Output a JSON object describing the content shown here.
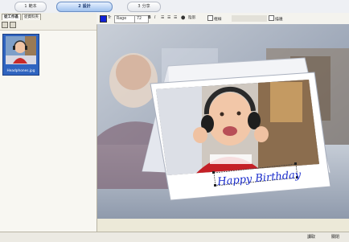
{
  "steps": [
    {
      "num": "1",
      "label": "範本"
    },
    {
      "num": "2",
      "label": "設計"
    },
    {
      "num": "3",
      "label": "分享"
    }
  ],
  "tabs": {
    "active": "從工作區",
    "other": "從資料夾"
  },
  "thumb": {
    "filename": "Headphones.jpg"
  },
  "toolbar": {
    "font_prefix": "Tr",
    "font_name": "Rage",
    "font_size": "72",
    "bold": "B",
    "italic": "I",
    "shadow_label": "陰影",
    "border_label": "框線",
    "outline_label": "描邊"
  },
  "canvas": {
    "greeting": "Happy Birthday"
  },
  "bottom": {
    "back_label": "讀取",
    "next_label": "關閉"
  },
  "colors": {
    "accent": "#1022d8",
    "step_active": "#9fc1ee",
    "text_blue": "#1a2ccc"
  }
}
